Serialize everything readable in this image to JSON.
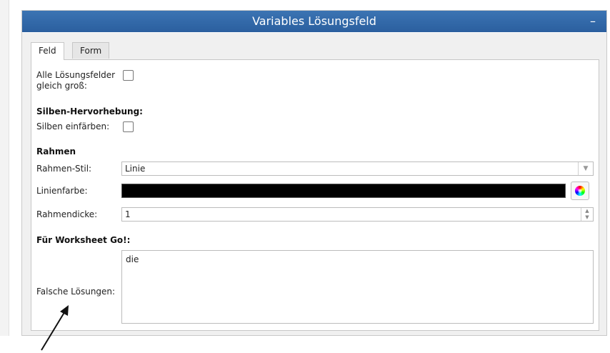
{
  "panel": {
    "title": "Variables Lösungsfeld",
    "collapse_symbol": "–"
  },
  "tabs": [
    {
      "label": "Feld",
      "active": true
    },
    {
      "label": "Form",
      "active": false
    }
  ],
  "form": {
    "same_size_label_line1": "Alle Lösungsfelder",
    "same_size_label_line2": "gleich groß:",
    "same_size_checked": false,
    "syllable_section": "Silben-Hervorhebung:",
    "syllable_color_label": "Silben einfärben:",
    "syllable_color_checked": false,
    "frame_section": "Rahmen",
    "frame_style_label": "Rahmen-Stil:",
    "frame_style_value": "Linie",
    "line_color_label": "Linienfarbe:",
    "line_color_value": "#000000",
    "frame_thickness_label": "Rahmendicke:",
    "frame_thickness_value": "1",
    "worksheet_section": "Für Worksheet Go!:",
    "wrong_solutions_label": "Falsche Lösungen:",
    "wrong_solutions_value": "die"
  },
  "icons": {
    "dropdown": "▼",
    "spin_up": "▲",
    "spin_down": "▼",
    "color_picker": "color-wheel-icon"
  }
}
